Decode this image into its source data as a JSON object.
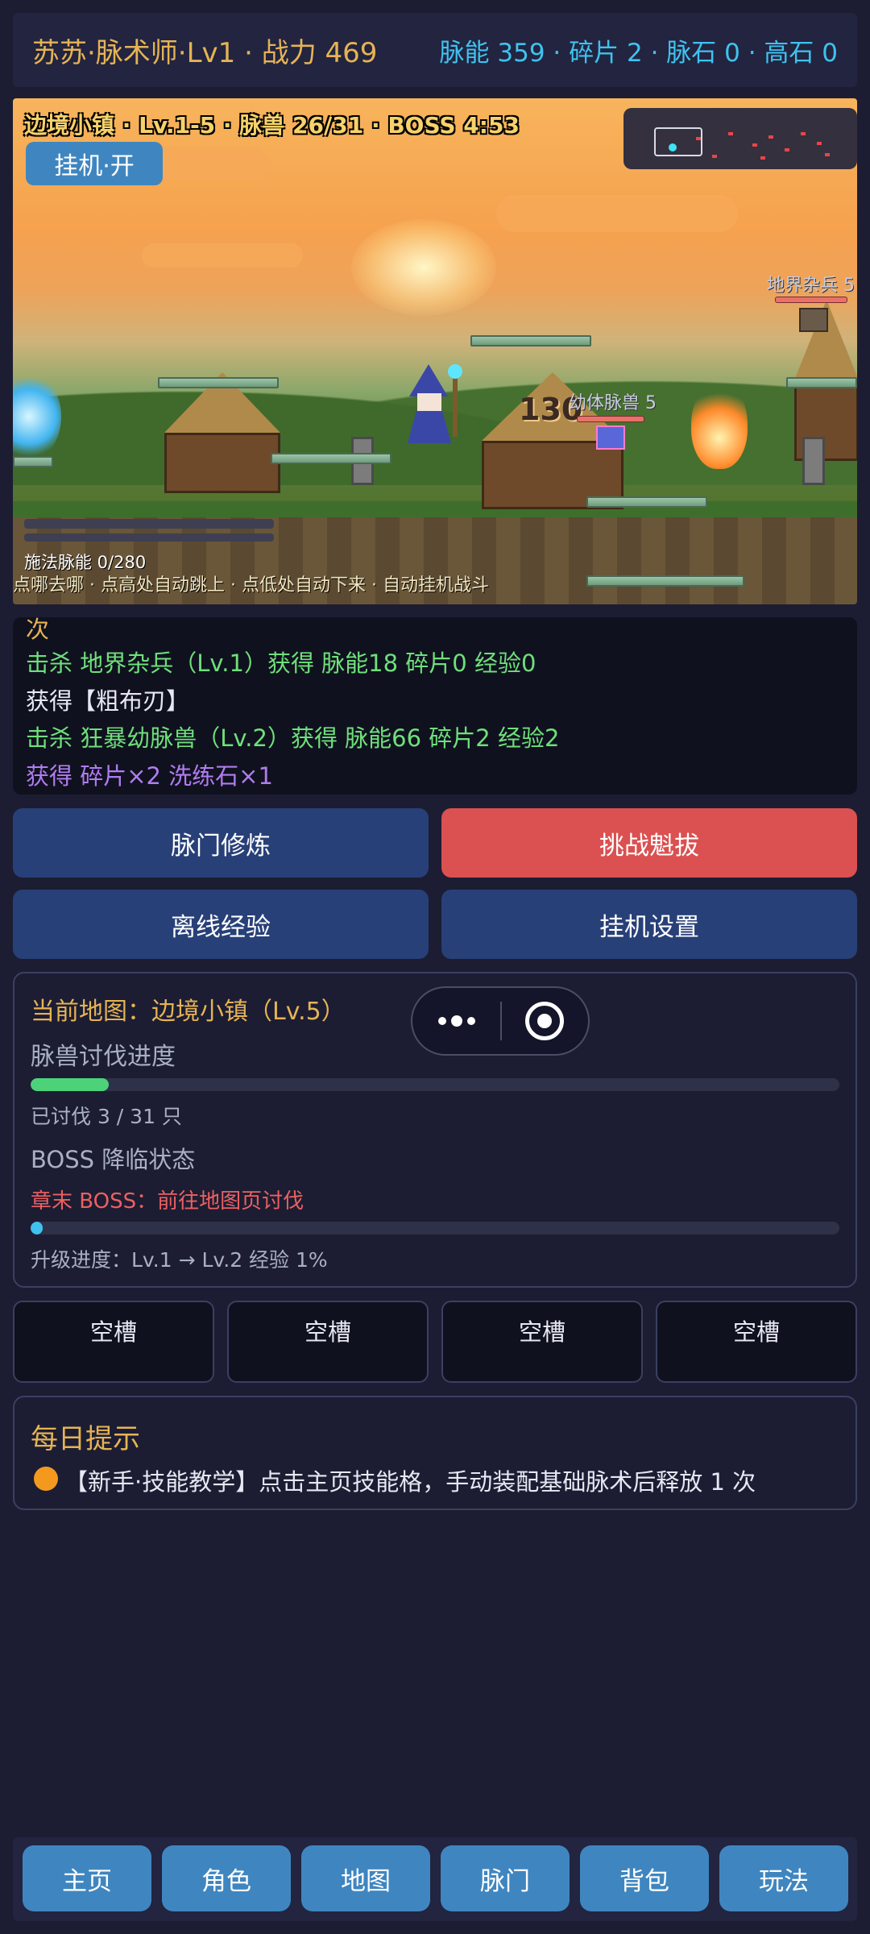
{
  "header": {
    "player": "苏苏·脉术师·Lv1 · 战力 469",
    "resources": "脉能 359 · 碎片 2 · 脉石 0 · 高石 0"
  },
  "game": {
    "hud": "边境小镇 · Lv.1-5 · 脉兽 26/31 · BOSS 4:53",
    "auto_label": "挂机·开",
    "enemy1_name": "地界杂兵 5",
    "enemy2_name": "幼体脉兽 5",
    "damage": "130",
    "mana": "施法脉能 0/280",
    "hint": "点哪去哪 · 点高处自动跳上 · 点低处自动下来 · 自动挂机战斗"
  },
  "log": [
    {
      "text": "次",
      "color": "#e6b354"
    },
    {
      "text": "击杀 地界杂兵（Lv.1）获得 脉能18 碎片0 经验0",
      "color": "#6ee07a"
    },
    {
      "text": "获得【粗布刃】",
      "color": "#e6e8f2"
    },
    {
      "text": "击杀 狂暴幼脉兽（Lv.2）获得 脉能66 碎片2 经验2",
      "color": "#6ee07a"
    },
    {
      "text": "获得 碎片×2 洗练石×1",
      "color": "#b07cf0"
    }
  ],
  "actions": {
    "cultivate": "脉门修炼",
    "challenge": "挑战魁拔",
    "offline": "离线经验",
    "settings": "挂机设置"
  },
  "map_panel": {
    "current_map": "当前地图：边境小镇（Lv.5）",
    "hunt_title": "脉兽讨伐进度",
    "hunt_progress": 0.097,
    "hunt_count": "已讨伐 3 / 31 只",
    "boss_title": "BOSS 降临状态",
    "boss_hint": "章末 BOSS：前往地图页讨伐",
    "exp_progress": 0.01,
    "level_progress": "升级进度：Lv.1 → Lv.2   经验 1%"
  },
  "slots": [
    "空槽",
    "空槽",
    "空槽",
    "空槽"
  ],
  "daily_tip": {
    "title": "每日提示",
    "text": "【新手·技能教学】点击主页技能格，手动装配基础脉术后释放 1 次"
  },
  "nav": [
    "主页",
    "角色",
    "地图",
    "脉门",
    "背包",
    "玩法"
  ],
  "colors": {
    "accent_gold": "#e6b354",
    "accent_cyan": "#3fc2ef",
    "button_blue": "#284078",
    "button_red": "#db5050",
    "nav_blue": "#3f86c0",
    "hunt_bar": "#4cd37a",
    "exp_bar": "#3fc2ef"
  }
}
